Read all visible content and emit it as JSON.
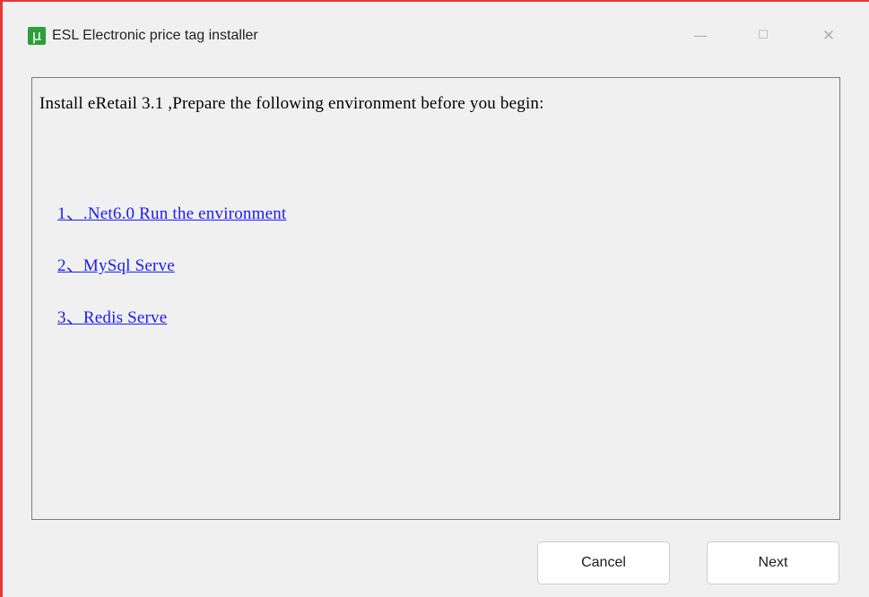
{
  "window": {
    "title": "ESL Electronic price tag installer",
    "app_icon_glyph": "μ",
    "app_icon_color": "#2e9e3a",
    "controls": {
      "minimize": "—",
      "maximize": "☐",
      "close": "✕"
    }
  },
  "content": {
    "intro": "Install eRetail 3.1 ,Prepare the following environment before you begin:",
    "links": [
      {
        "label": "1、.Net6.0 Run the environment"
      },
      {
        "label": "2、MySql Serve"
      },
      {
        "label": "3、Redis Serve"
      }
    ],
    "link_color": "#1a1aff"
  },
  "footer": {
    "cancel_label": "Cancel",
    "next_label": "Next"
  }
}
